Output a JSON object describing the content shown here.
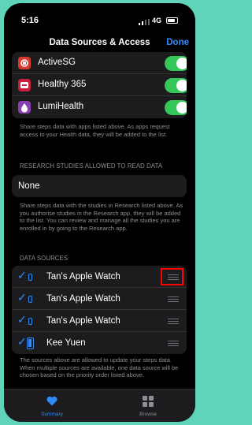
{
  "status": {
    "time": "5:16",
    "network": "4G"
  },
  "nav": {
    "title": "Data Sources & Access",
    "done": "Done"
  },
  "apps": [
    {
      "name": "ActiveSG",
      "icon": "activesg-icon",
      "color": "#d93a2f"
    },
    {
      "name": "Healthy 365",
      "icon": "healthy365-icon",
      "color": "#c8203a"
    },
    {
      "name": "LumiHealth",
      "icon": "lumihealth-icon",
      "color": "#8a3fb0"
    }
  ],
  "apps_note": "Share steps data with apps listed above. As apps request access to your Health data, they will be added to the list.",
  "research": {
    "header": "RESEARCH STUDIES ALLOWED TO READ DATA",
    "value": "None",
    "note": "Share steps data with the studies in Research listed above. As you authorise studies in the Research app, they will be added to the list. You can review and manage all the studies you are enrolled in by going to the Research app."
  },
  "sources": {
    "header": "DATA SOURCES",
    "items": [
      {
        "name": "Tan's Apple Watch",
        "device": "watch-icon"
      },
      {
        "name": "Tan's Apple Watch",
        "device": "watch-icon"
      },
      {
        "name": "Tan's Apple Watch",
        "device": "watch-icon"
      },
      {
        "name": "Kee Yuen",
        "device": "iphone-icon"
      }
    ],
    "note": "The sources above are allowed to update your steps data. When multiple sources are available, one data source will be chosen based on the priority order listed above."
  },
  "tabs": [
    {
      "label": "Summary",
      "active": true
    },
    {
      "label": "Browse",
      "active": false
    }
  ],
  "colors": {
    "accent": "#2f8bf7",
    "toggle_on": "#35c759",
    "highlight": "#ff0000",
    "background": "#5fd4ba"
  }
}
